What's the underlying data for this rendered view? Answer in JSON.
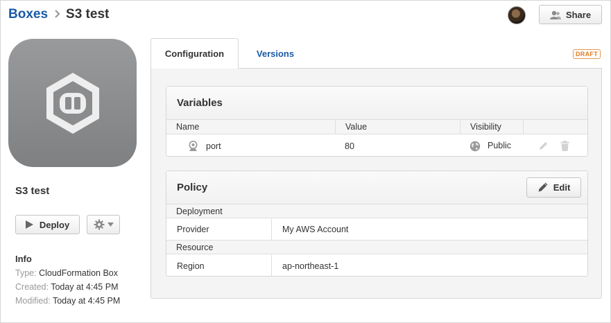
{
  "header": {
    "breadcrumb_root": "Boxes",
    "breadcrumb_current": "S3 test",
    "share_label": "Share"
  },
  "box": {
    "name": "S3 test",
    "deploy_label": "Deploy"
  },
  "info": {
    "title": "Info",
    "type_label": "Type:",
    "type_value": "CloudFormation Box",
    "created_label": "Created:",
    "created_value": "Today at 4:45 PM",
    "modified_label": "Modified:",
    "modified_value": "Today at 4:45 PM"
  },
  "tabs": [
    {
      "label": "Configuration",
      "active": true
    },
    {
      "label": "Versions",
      "active": false
    }
  ],
  "draft_badge": "DRAFT",
  "variables": {
    "title": "Variables",
    "columns": [
      "Name",
      "Value",
      "Visibility"
    ],
    "rows": [
      {
        "name": "port",
        "value": "80",
        "visibility": "Public"
      }
    ]
  },
  "policy": {
    "title": "Policy",
    "edit_label": "Edit",
    "sections": [
      {
        "title": "Deployment",
        "rows": [
          {
            "key": "Provider",
            "value": "My AWS Account"
          }
        ]
      },
      {
        "title": "Resource",
        "rows": [
          {
            "key": "Region",
            "value": "ap-northeast-1"
          }
        ]
      }
    ]
  },
  "colors": {
    "link": "#1a5aa6",
    "draft": "#e07b22",
    "logo_bg": "#8a8b8d"
  },
  "icons": [
    "chevron-right-icon",
    "user-icon",
    "box-hexagon-icon",
    "play-icon",
    "gear-icon",
    "caret-down-icon",
    "variable-icon",
    "globe-icon",
    "pencil-icon",
    "trash-icon"
  ]
}
